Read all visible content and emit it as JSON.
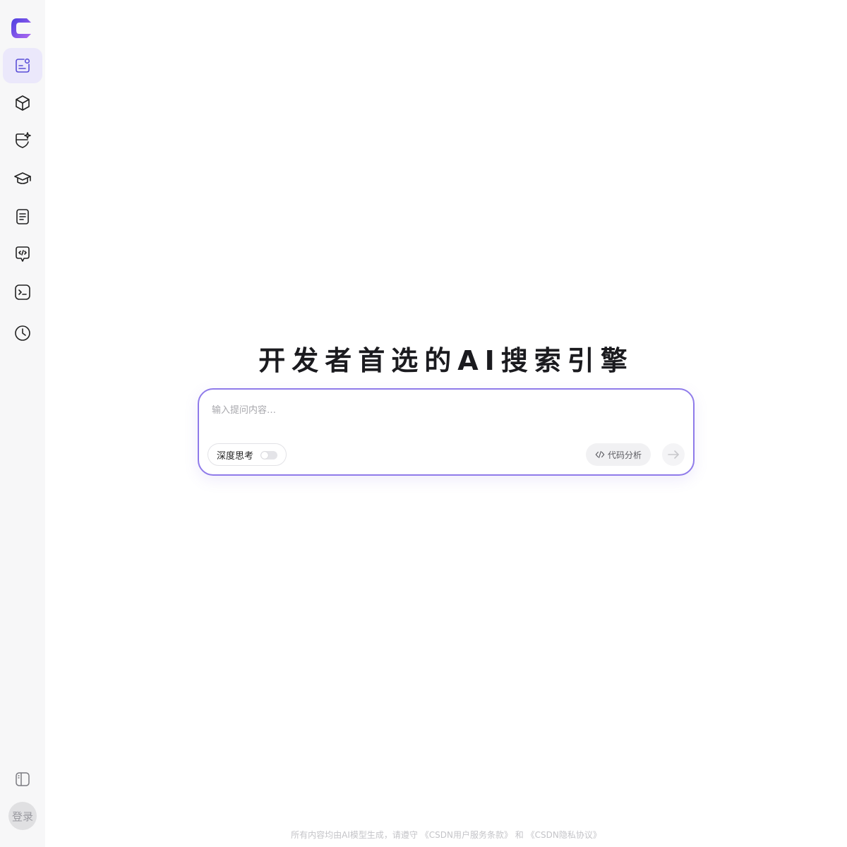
{
  "sidebar": {
    "items": [
      {
        "name": "new-chat-icon",
        "active": true
      },
      {
        "name": "cube-icon",
        "active": false
      },
      {
        "name": "sparkle-shield-icon",
        "active": false
      },
      {
        "name": "graduation-cap-icon",
        "active": false
      },
      {
        "name": "document-icon",
        "active": false
      },
      {
        "name": "code-chat-icon",
        "active": false
      },
      {
        "name": "terminal-icon",
        "active": false
      },
      {
        "name": "history-clock-icon",
        "active": false
      }
    ],
    "toggle_icon": "sidebar-toggle-icon",
    "login_label": "登录"
  },
  "main": {
    "title": "开发者首选的AI搜索引擎",
    "input": {
      "placeholder": "输入提问内容…"
    },
    "deep_think_label": "深度思考",
    "deep_think_enabled": false,
    "code_analysis_label": "代码分析",
    "send_icon": "arrow-right-icon"
  },
  "footer": {
    "prefix": "所有内容均由AI模型生成，请遵守",
    "terms_link": "《CSDN用户服务条款》",
    "and": "和",
    "privacy_link": "《CSDN隐私协议》"
  },
  "colors": {
    "accent": "#8f7bea",
    "sidebar_bg": "#f7f7f8",
    "active_nav_bg": "#ebe8fb"
  }
}
